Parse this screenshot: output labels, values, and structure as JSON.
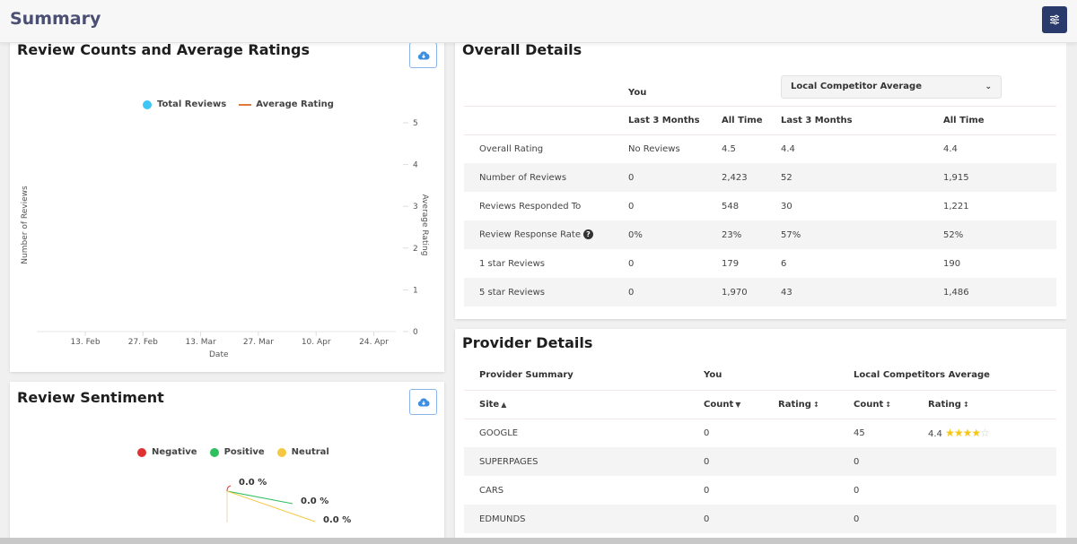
{
  "header": {
    "title": "Summary",
    "filter_icon": "sliders-icon"
  },
  "review_counts_chart": {
    "title": "Review Counts and Average Ratings",
    "download_icon": "cloud-download-icon",
    "chart_data": {
      "type": "line",
      "title": "Review Counts and Average Ratings",
      "legend": [
        {
          "name": "Total Reviews",
          "color": "#3ec6f5",
          "marker": "dot"
        },
        {
          "name": "Average Rating",
          "color": "#e07a3a",
          "marker": "line"
        }
      ],
      "legend_position": "top-center",
      "xlabel": "Date",
      "ylabel_left": "Number of Reviews",
      "ylabel_right": "Average Rating",
      "x_ticks": [
        "13. Feb",
        "27. Feb",
        "13. Mar",
        "27. Mar",
        "10. Apr",
        "24. Apr"
      ],
      "y_right_ticks": [
        0,
        1,
        2,
        3,
        4,
        5
      ],
      "y_right_range": [
        0,
        5
      ],
      "series": [
        {
          "name": "Total Reviews",
          "values": []
        },
        {
          "name": "Average Rating",
          "values": []
        }
      ]
    }
  },
  "sentiment_chart": {
    "title": "Review Sentiment",
    "download_icon": "cloud-download-icon",
    "chart_data": {
      "type": "pie",
      "title": "Review Sentiment",
      "legend_position": "top-center",
      "slices": [
        {
          "name": "Negative",
          "value": 0.0,
          "label": "0.0 %",
          "color": "#e03131"
        },
        {
          "name": "Positive",
          "value": 0.0,
          "label": "0.0 %",
          "color": "#2fbf5f"
        },
        {
          "name": "Neutral",
          "value": 0.0,
          "label": "0.0 %",
          "color": "#f5c842"
        }
      ]
    }
  },
  "overall_details": {
    "title": "Overall Details",
    "you_label": "You",
    "competitor_select": {
      "selected": "Local Competitor Average"
    },
    "columns": [
      "",
      "Last 3 Months",
      "All Time",
      "Last 3 Months",
      "All Time"
    ],
    "rows": [
      {
        "label": "Overall Rating",
        "you_3m": "No Reviews",
        "you_all": "4.5",
        "comp_3m": "4.4",
        "comp_all": "4.4"
      },
      {
        "label": "Number of Reviews",
        "you_3m": "0",
        "you_all": "2,423",
        "comp_3m": "52",
        "comp_all": "1,915"
      },
      {
        "label": "Reviews Responded To",
        "you_3m": "0",
        "you_all": "548",
        "comp_3m": "30",
        "comp_all": "1,221"
      },
      {
        "label": "Review Response Rate",
        "you_3m": "0%",
        "you_all": "23%",
        "comp_3m": "57%",
        "comp_all": "52%",
        "help": "?"
      },
      {
        "label": "1 star Reviews",
        "you_3m": "0",
        "you_all": "179",
        "comp_3m": "6",
        "comp_all": "190"
      },
      {
        "label": "5 star Reviews",
        "you_3m": "0",
        "you_all": "1,970",
        "comp_3m": "43",
        "comp_all": "1,486"
      }
    ]
  },
  "provider_details": {
    "title": "Provider Details",
    "group_headers": [
      "Provider Summary",
      "You",
      "Local Competitors Average"
    ],
    "columns": [
      "Site",
      "Count",
      "Rating",
      "Count",
      "Rating"
    ],
    "rows": [
      {
        "site": "GOOGLE",
        "you_count": "0",
        "you_rating": "",
        "comp_count": "45",
        "comp_rating": "4.4",
        "comp_stars": 4.4
      },
      {
        "site": "SUPERPAGES",
        "you_count": "0",
        "you_rating": "",
        "comp_count": "0",
        "comp_rating": ""
      },
      {
        "site": "CARS",
        "you_count": "0",
        "you_rating": "",
        "comp_count": "0",
        "comp_rating": ""
      },
      {
        "site": "EDMUNDS",
        "you_count": "0",
        "you_rating": "",
        "comp_count": "0",
        "comp_rating": ""
      }
    ]
  }
}
